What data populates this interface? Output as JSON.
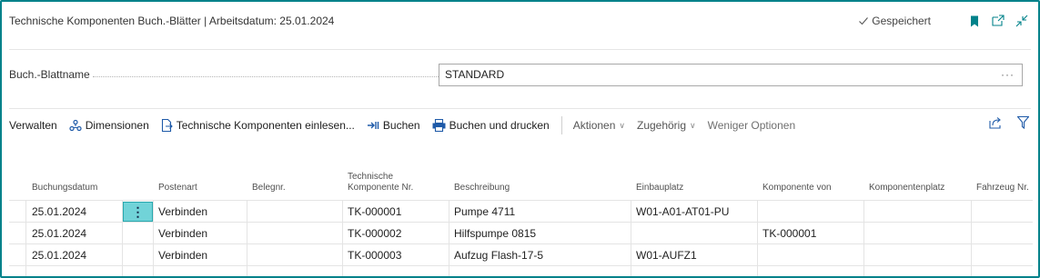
{
  "header": {
    "title": "Technische Komponenten Buch.-Blätter | Arbeitsdatum: 25.01.2024",
    "saved_label": "Gespeichert",
    "icons": [
      "check-icon",
      "bookmark-icon",
      "open-new-window-icon",
      "collapse-icon"
    ]
  },
  "field": {
    "label": "Buch.-Blattname",
    "value": "STANDARD",
    "lookup": "···"
  },
  "toolbar": {
    "verwalten": "Verwalten",
    "dimensionen": "Dimensionen",
    "einlesen": "Technische Komponenten einlesen...",
    "buchen": "Buchen",
    "buchen_drucken": "Buchen und drucken",
    "aktionen": "Aktionen",
    "zugehoerig": "Zugehörig",
    "weniger": "Weniger Optionen",
    "chevron": "∨"
  },
  "columns": {
    "buchungsdatum": "Buchungsdatum",
    "postenart": "Postenart",
    "belegnr": "Belegnr.",
    "tk_nr_1": "Technische",
    "tk_nr_2": "Komponente Nr.",
    "beschreibung": "Beschreibung",
    "einbauplatz": "Einbauplatz",
    "komponente_von": "Komponente von",
    "komponentenplatz": "Komponentenplatz",
    "fahrzeug": "Fahrzeug Nr."
  },
  "rows": [
    {
      "datum": "25.01.2024",
      "postenart": "Verbinden",
      "belegnr": "",
      "tk": "TK-000001",
      "beschreibung": "Pumpe 4711",
      "einbauplatz": "W01-A01-AT01-PU",
      "komponente_von": "",
      "komponentenplatz": "",
      "fahrzeug": ""
    },
    {
      "datum": "25.01.2024",
      "postenart": "Verbinden",
      "belegnr": "",
      "tk": "TK-000002",
      "beschreibung": "Hilfspumpe 0815",
      "einbauplatz": "",
      "komponente_von": "TK-000001",
      "komponentenplatz": "",
      "fahrzeug": ""
    },
    {
      "datum": "25.01.2024",
      "postenart": "Verbinden",
      "belegnr": "",
      "tk": "TK-000003",
      "beschreibung": "Aufzug Flash-17-5",
      "einbauplatz": "W01-AUFZ1",
      "komponente_von": "",
      "komponentenplatz": "",
      "fahrzeug": ""
    }
  ],
  "row_menu": "⋮",
  "colors": {
    "accent": "#00828a",
    "row_menu": "#71d3d8"
  }
}
